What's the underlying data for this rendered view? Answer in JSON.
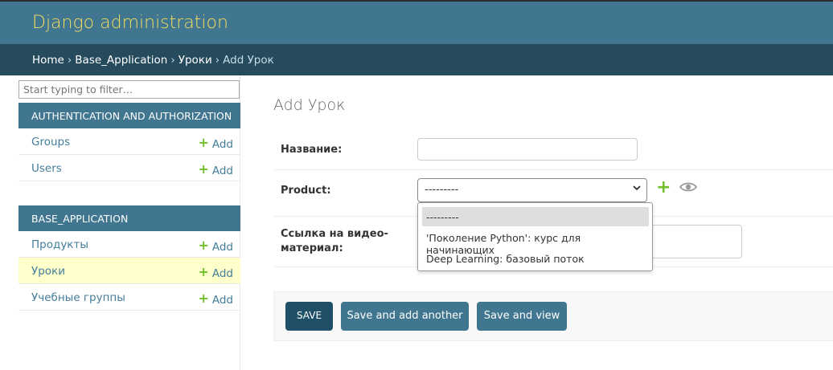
{
  "header": {
    "site_name": "Django administration"
  },
  "breadcrumbs": {
    "home": "Home",
    "app": "Base_Application",
    "model": "Уроки",
    "current": "Add Урок",
    "separator": "›"
  },
  "sidebar": {
    "filter_placeholder": "Start typing to filter…",
    "modules": [
      {
        "caption": "AUTHENTICATION AND AUTHORIZATION",
        "items": [
          {
            "label": "Groups",
            "add": "Add"
          },
          {
            "label": "Users",
            "add": "Add"
          }
        ]
      },
      {
        "caption": "BASE_APPLICATION",
        "items": [
          {
            "label": "Продукты",
            "add": "Add"
          },
          {
            "label": "Уроки",
            "add": "Add",
            "active": true
          },
          {
            "label": "Учебные группы",
            "add": "Add"
          }
        ]
      }
    ]
  },
  "main": {
    "title": "Add Урок",
    "fields": {
      "name_label": "Название:",
      "product_label": "Product:",
      "video_label_line1": "Ссылка на видео-",
      "video_label_line2": "материал:"
    },
    "product_select": {
      "value": "---------",
      "options": [
        "---------",
        "'Поколение Python': курс для начинающих",
        "Deep Learning: базовый поток"
      ],
      "selected_index": 0
    },
    "buttons": {
      "save": "SAVE",
      "save_add_another": "Save and add another",
      "save_view": "Save and view"
    }
  },
  "colors": {
    "header": "#417690",
    "breadcrumbs": "#264b5d",
    "site_name": "#f5dd5d",
    "add_icon": "#70bf2b",
    "active_row": "#ffffcc",
    "save_button": "#205067"
  }
}
